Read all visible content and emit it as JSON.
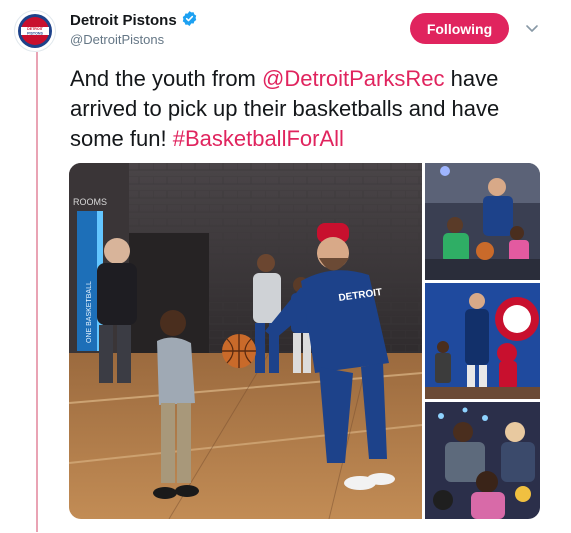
{
  "author": {
    "name": "Detroit Pistons",
    "handle": "@DetroitPistons",
    "avatar_text_top": "DETROIT",
    "avatar_text_bottom": "PISTONS",
    "verified_icon": "verified-badge-icon"
  },
  "follow_button": {
    "label": "Following"
  },
  "menu": {
    "icon": "chevron-down-icon"
  },
  "tweet": {
    "text_part1": "And the youth from ",
    "mention": "@DetroitParksRec",
    "text_part2": " have arrived to pick up their basketballs and have some fun! ",
    "hashtag": "#BasketballForAll"
  },
  "media": {
    "photos": [
      {
        "name": "main-photo",
        "sign_text": "ROOMS",
        "banner_text": "ONE BASKETBALL",
        "shirt_text": "DETROIT"
      },
      {
        "name": "side-photo-1"
      },
      {
        "name": "side-photo-2"
      },
      {
        "name": "side-photo-3"
      }
    ]
  },
  "colors": {
    "accent": "#e0245e",
    "thread_line": "#e9a3b4",
    "verified": "#1da1f2",
    "text": "#14171a",
    "muted": "#657786",
    "pistons_red": "#c8102e",
    "pistons_blue": "#1d428a"
  }
}
